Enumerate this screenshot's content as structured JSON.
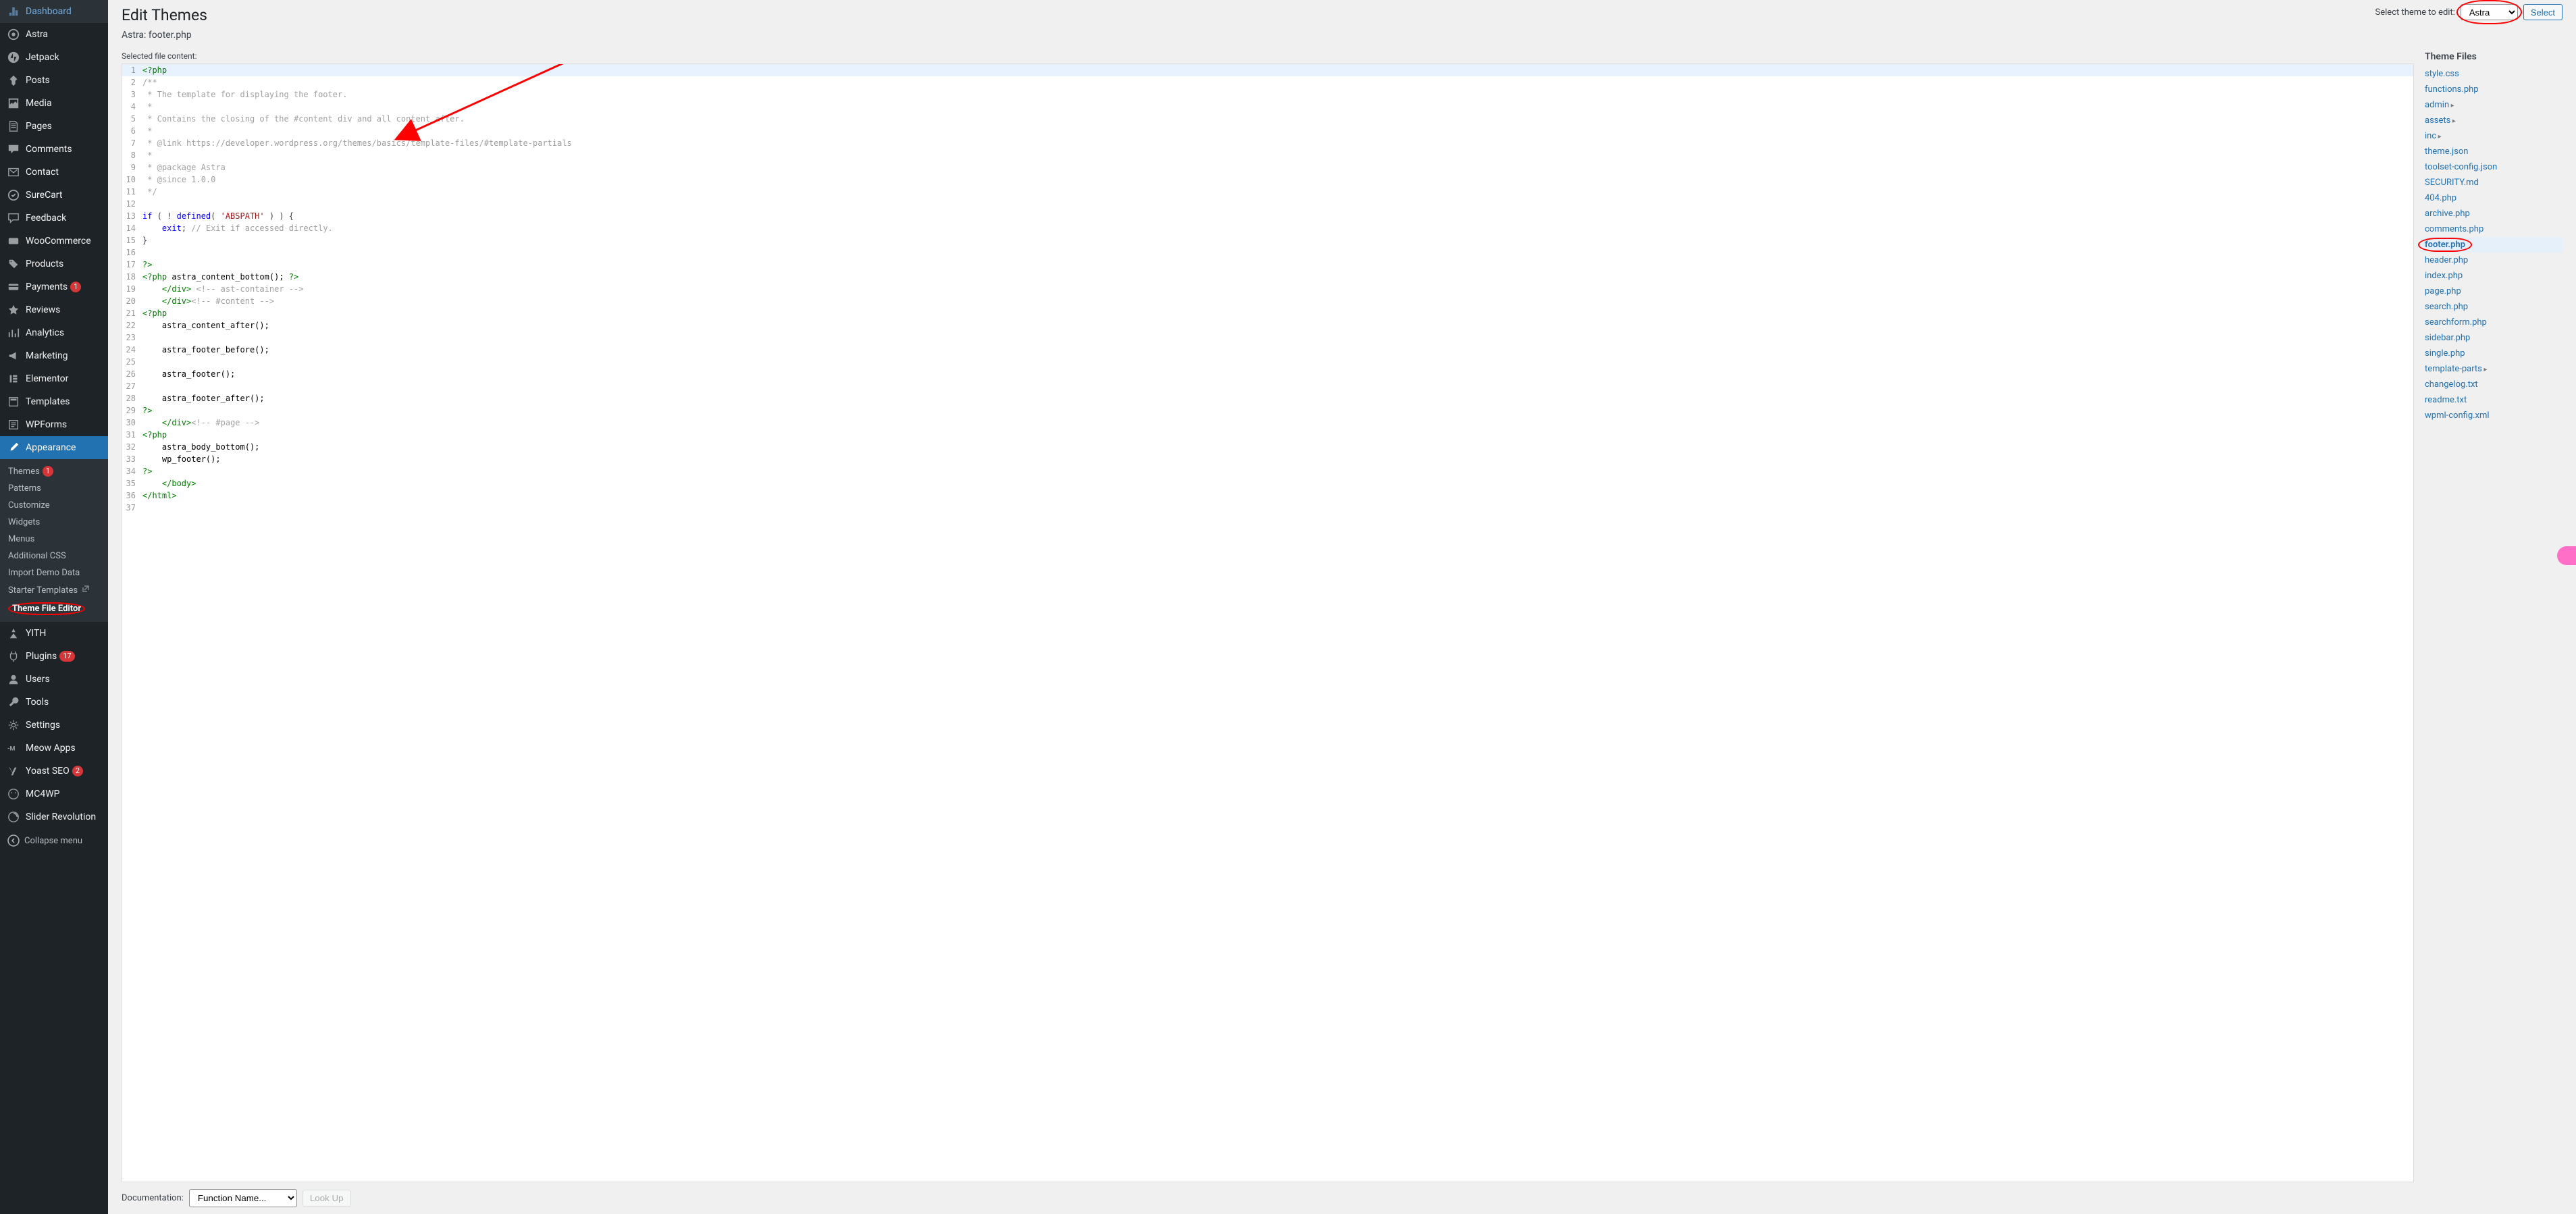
{
  "page": {
    "title": "Edit Themes",
    "file_title": "Astra: footer.php",
    "selected_label": "Selected file content:"
  },
  "theme_selector": {
    "label": "Select theme to edit:",
    "value": "Astra",
    "button": "Select"
  },
  "documentation": {
    "label": "Documentation:",
    "select_placeholder": "Function Name...",
    "button": "Look Up"
  },
  "sidebar": {
    "items": [
      {
        "label": "Dashboard",
        "icon": "dashboard"
      },
      {
        "label": "Astra",
        "icon": "astra"
      },
      {
        "label": "Jetpack",
        "icon": "jetpack"
      },
      {
        "label": "Posts",
        "icon": "pin"
      },
      {
        "label": "Media",
        "icon": "media"
      },
      {
        "label": "Pages",
        "icon": "page"
      },
      {
        "label": "Comments",
        "icon": "comment"
      },
      {
        "label": "Contact",
        "icon": "contact"
      },
      {
        "label": "SureCart",
        "icon": "surecart"
      },
      {
        "label": "Feedback",
        "icon": "feedback"
      },
      {
        "label": "WooCommerce",
        "icon": "woo"
      },
      {
        "label": "Products",
        "icon": "product"
      },
      {
        "label": "Payments",
        "icon": "payment",
        "badge": "1"
      },
      {
        "label": "Reviews",
        "icon": "star"
      },
      {
        "label": "Analytics",
        "icon": "chart"
      },
      {
        "label": "Marketing",
        "icon": "megaphone"
      },
      {
        "label": "Elementor",
        "icon": "elementor"
      },
      {
        "label": "Templates",
        "icon": "template"
      },
      {
        "label": "WPForms",
        "icon": "wpforms"
      },
      {
        "label": "Appearance",
        "icon": "brush",
        "active": true,
        "submenu": [
          {
            "label": "Themes",
            "badge": "1"
          },
          {
            "label": "Patterns"
          },
          {
            "label": "Customize"
          },
          {
            "label": "Widgets"
          },
          {
            "label": "Menus"
          },
          {
            "label": "Additional CSS"
          },
          {
            "label": "Import Demo Data"
          },
          {
            "label": "Starter Templates",
            "ext": true
          },
          {
            "label": "Theme File Editor",
            "current": true,
            "circled": true
          }
        ]
      },
      {
        "label": "YITH",
        "icon": "yith"
      },
      {
        "label": "Plugins",
        "icon": "plugin",
        "badge": "17"
      },
      {
        "label": "Users",
        "icon": "user"
      },
      {
        "label": "Tools",
        "icon": "wrench"
      },
      {
        "label": "Settings",
        "icon": "gear"
      },
      {
        "label": "Meow Apps",
        "icon": "meow"
      },
      {
        "label": "Yoast SEO",
        "icon": "yoast",
        "badge": "2"
      },
      {
        "label": "MC4WP",
        "icon": "mc4wp"
      },
      {
        "label": "Slider Revolution",
        "icon": "slider"
      }
    ],
    "collapse": "Collapse menu"
  },
  "files": {
    "heading": "Theme Files",
    "list": [
      {
        "name": "style.css"
      },
      {
        "name": "functions.php"
      },
      {
        "name": "admin",
        "dir": true
      },
      {
        "name": "assets",
        "dir": true
      },
      {
        "name": "inc",
        "dir": true
      },
      {
        "name": "theme.json"
      },
      {
        "name": "toolset-config.json"
      },
      {
        "name": "SECURITY.md"
      },
      {
        "name": "404.php"
      },
      {
        "name": "archive.php"
      },
      {
        "name": "comments.php"
      },
      {
        "name": "footer.php",
        "current": true,
        "circled": true
      },
      {
        "name": "header.php"
      },
      {
        "name": "index.php"
      },
      {
        "name": "page.php"
      },
      {
        "name": "search.php"
      },
      {
        "name": "searchform.php"
      },
      {
        "name": "sidebar.php"
      },
      {
        "name": "single.php"
      },
      {
        "name": "template-parts",
        "dir": true
      },
      {
        "name": "changelog.txt"
      },
      {
        "name": "readme.txt"
      },
      {
        "name": "wpml-config.xml"
      }
    ]
  },
  "code": [
    {
      "n": 1,
      "hl": true,
      "segs": [
        {
          "t": "<?php",
          "c": "c-php"
        }
      ]
    },
    {
      "n": 2,
      "segs": [
        {
          "t": "/**",
          "c": "c-com"
        }
      ]
    },
    {
      "n": 3,
      "segs": [
        {
          "t": " * The template for displaying the footer.",
          "c": "c-com"
        }
      ]
    },
    {
      "n": 4,
      "segs": [
        {
          "t": " *",
          "c": "c-com"
        }
      ]
    },
    {
      "n": 5,
      "segs": [
        {
          "t": " * Contains the closing of the #content div and all content after.",
          "c": "c-com"
        }
      ]
    },
    {
      "n": 6,
      "segs": [
        {
          "t": " *",
          "c": "c-com"
        }
      ]
    },
    {
      "n": 7,
      "segs": [
        {
          "t": " * @link https://developer.wordpress.org/themes/basics/template-files/#template-partials",
          "c": "c-com"
        }
      ]
    },
    {
      "n": 8,
      "segs": [
        {
          "t": " *",
          "c": "c-com"
        }
      ]
    },
    {
      "n": 9,
      "segs": [
        {
          "t": " * @package Astra",
          "c": "c-com"
        }
      ]
    },
    {
      "n": 10,
      "segs": [
        {
          "t": " * @since 1.0.0",
          "c": "c-com"
        }
      ]
    },
    {
      "n": 11,
      "segs": [
        {
          "t": " */",
          "c": "c-com"
        }
      ]
    },
    {
      "n": 12,
      "segs": [
        {
          "t": "",
          "c": ""
        }
      ]
    },
    {
      "n": 13,
      "segs": [
        {
          "t": "if",
          "c": "c-kw"
        },
        {
          "t": " ( ! ",
          "c": ""
        },
        {
          "t": "defined",
          "c": "c-kw"
        },
        {
          "t": "( ",
          "c": ""
        },
        {
          "t": "'ABSPATH'",
          "c": "c-str"
        },
        {
          "t": " ) ) {",
          "c": ""
        }
      ]
    },
    {
      "n": 14,
      "segs": [
        {
          "t": "    ",
          "c": ""
        },
        {
          "t": "exit",
          "c": "c-kw"
        },
        {
          "t": "; ",
          "c": ""
        },
        {
          "t": "// Exit if accessed directly.",
          "c": "c-com"
        }
      ]
    },
    {
      "n": 15,
      "segs": [
        {
          "t": "}",
          "c": ""
        }
      ]
    },
    {
      "n": 16,
      "segs": [
        {
          "t": "",
          "c": ""
        }
      ]
    },
    {
      "n": 17,
      "segs": [
        {
          "t": "?>",
          "c": "c-php"
        }
      ]
    },
    {
      "n": 18,
      "segs": [
        {
          "t": "<?php",
          "c": "c-php"
        },
        {
          "t": " astra_content_bottom(); ",
          "c": "c-fn"
        },
        {
          "t": "?>",
          "c": "c-php"
        }
      ]
    },
    {
      "n": 19,
      "segs": [
        {
          "t": "    </",
          "c": "c-tag"
        },
        {
          "t": "div",
          "c": "c-tag"
        },
        {
          "t": ">",
          "c": "c-tag"
        },
        {
          "t": " <!-- ast-container -->",
          "c": "c-com"
        }
      ]
    },
    {
      "n": 20,
      "segs": [
        {
          "t": "    </",
          "c": "c-tag"
        },
        {
          "t": "div",
          "c": "c-tag"
        },
        {
          "t": ">",
          "c": "c-tag"
        },
        {
          "t": "<!-- #content -->",
          "c": "c-com"
        }
      ]
    },
    {
      "n": 21,
      "segs": [
        {
          "t": "<?php",
          "c": "c-php"
        }
      ]
    },
    {
      "n": 22,
      "segs": [
        {
          "t": "    astra_content_after();",
          "c": "c-fn"
        }
      ]
    },
    {
      "n": 23,
      "segs": [
        {
          "t": "",
          "c": ""
        }
      ]
    },
    {
      "n": 24,
      "segs": [
        {
          "t": "    astra_footer_before();",
          "c": "c-fn"
        }
      ]
    },
    {
      "n": 25,
      "segs": [
        {
          "t": "",
          "c": ""
        }
      ]
    },
    {
      "n": 26,
      "segs": [
        {
          "t": "    astra_footer();",
          "c": "c-fn"
        }
      ]
    },
    {
      "n": 27,
      "segs": [
        {
          "t": "",
          "c": ""
        }
      ]
    },
    {
      "n": 28,
      "segs": [
        {
          "t": "    astra_footer_after();",
          "c": "c-fn"
        }
      ]
    },
    {
      "n": 29,
      "segs": [
        {
          "t": "?>",
          "c": "c-php"
        }
      ]
    },
    {
      "n": 30,
      "segs": [
        {
          "t": "    </",
          "c": "c-tag"
        },
        {
          "t": "div",
          "c": "c-tag"
        },
        {
          "t": ">",
          "c": "c-tag"
        },
        {
          "t": "<!-- #page -->",
          "c": "c-com"
        }
      ]
    },
    {
      "n": 31,
      "segs": [
        {
          "t": "<?php",
          "c": "c-php"
        }
      ]
    },
    {
      "n": 32,
      "segs": [
        {
          "t": "    astra_body_bottom();",
          "c": "c-fn"
        }
      ]
    },
    {
      "n": 33,
      "segs": [
        {
          "t": "    wp_footer();",
          "c": "c-fn"
        }
      ]
    },
    {
      "n": 34,
      "segs": [
        {
          "t": "?>",
          "c": "c-php"
        }
      ]
    },
    {
      "n": 35,
      "segs": [
        {
          "t": "    </",
          "c": "c-tag"
        },
        {
          "t": "body",
          "c": "c-tag"
        },
        {
          "t": ">",
          "c": "c-tag"
        }
      ]
    },
    {
      "n": 36,
      "segs": [
        {
          "t": "</",
          "c": "c-tag"
        },
        {
          "t": "html",
          "c": "c-tag"
        },
        {
          "t": ">",
          "c": "c-tag"
        }
      ]
    },
    {
      "n": 37,
      "segs": [
        {
          "t": "",
          "c": ""
        }
      ]
    }
  ]
}
